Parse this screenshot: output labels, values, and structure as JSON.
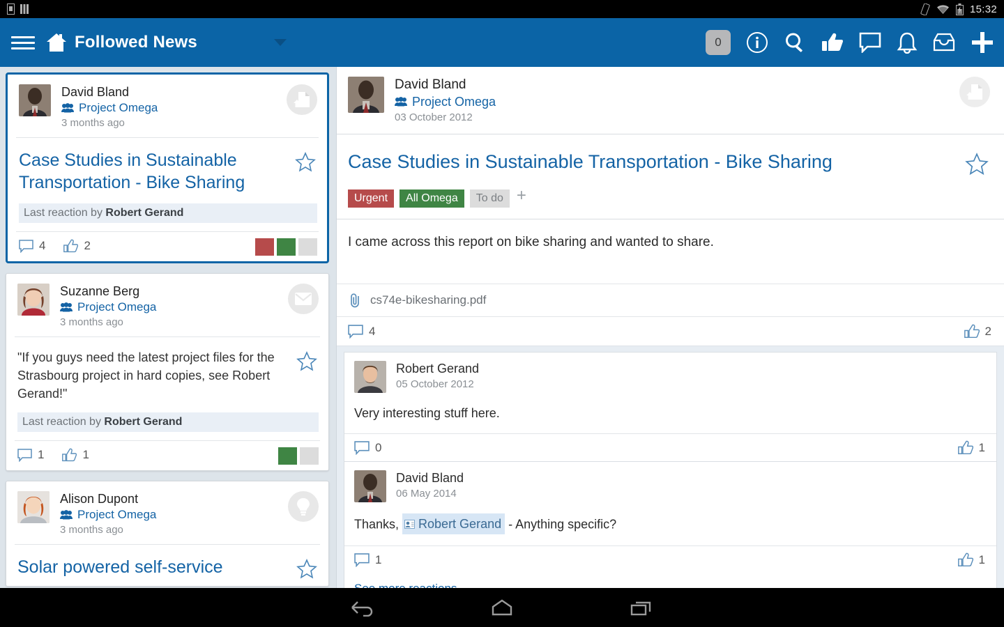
{
  "status_bar": {
    "time": "15:32",
    "icons": [
      "sim-card-icon",
      "signal-bars-icon",
      "rotation-lock-icon",
      "wifi-icon",
      "battery-charging-icon"
    ]
  },
  "app_bar": {
    "menu_icon": "hamburger-menu-icon",
    "home_icon": "home-icon",
    "title": "Followed News",
    "caret_icon": "chevron-down-icon",
    "actions": [
      {
        "name": "counter-badge",
        "label": "0",
        "icon": "counter-badge"
      },
      {
        "name": "info-button",
        "label": "",
        "icon": "info-circle-icon"
      },
      {
        "name": "search-button",
        "label": "",
        "icon": "search-icon"
      },
      {
        "name": "likes-button",
        "label": "",
        "icon": "thumbs-up-icon"
      },
      {
        "name": "comments-button",
        "label": "",
        "icon": "speech-bubble-icon"
      },
      {
        "name": "notifications-button",
        "label": "",
        "icon": "bell-icon"
      },
      {
        "name": "inbox-button",
        "label": "",
        "icon": "inbox-tray-icon"
      },
      {
        "name": "new-post-button",
        "label": "",
        "icon": "plus-icon"
      }
    ]
  },
  "colors": {
    "brand_blue": "#0b64a6",
    "link_blue": "#1463a5",
    "tag_red": "#b64b4b",
    "tag_green": "#3f8544",
    "tag_grey": "#dcdcdc",
    "sidebar_bg": "#dde4ea"
  },
  "sidebar": {
    "cards": [
      {
        "author": "David Bland",
        "group": "Project Omega",
        "group_icon": "group-people-icon",
        "time": "3 months ago",
        "type_icon": "document-upload-icon",
        "title": "Case Studies in Sustainable Transportation - Bike Sharing",
        "star_icon": "star-outline-icon",
        "last_reaction_prefix": "Last reaction by ",
        "last_reaction_name": "Robert Gerand",
        "comment_count": "4",
        "like_count": "2",
        "swatches": [
          "#b64b4b",
          "#3f8544",
          "#dcdcdc"
        ],
        "selected": true
      },
      {
        "author": "Suzanne Berg",
        "group": "Project Omega",
        "group_icon": "group-people-icon",
        "time": "3 months ago",
        "type_icon": "envelope-icon",
        "quote": "\"If you guys need the latest project files for the Strasbourg project in hard copies, see Robert Gerand!\"",
        "star_icon": "star-outline-icon",
        "last_reaction_prefix": "Last reaction by ",
        "last_reaction_name": "Robert Gerand",
        "comment_count": "1",
        "like_count": "1",
        "swatches": [
          "#3f8544",
          "#dcdcdc"
        ],
        "selected": false
      },
      {
        "author": "Alison Dupont",
        "group": "Project Omega",
        "group_icon": "group-people-icon",
        "time": "3 months ago",
        "type_icon": "lightbulb-icon",
        "title": "Solar powered self-service",
        "star_icon": "star-outline-icon",
        "selected": false
      }
    ]
  },
  "detail": {
    "author": "David Bland",
    "group": "Project Omega",
    "group_icon": "group-people-icon",
    "date": "03 October 2012",
    "type_icon": "document-upload-icon",
    "title": "Case Studies in Sustainable Transportation - Bike Sharing",
    "star_icon": "star-outline-icon",
    "tags": [
      {
        "label": "Urgent",
        "style": "red"
      },
      {
        "label": "All Omega",
        "style": "green"
      },
      {
        "label": "To do",
        "style": "grey"
      }
    ],
    "tag_add_label": "+",
    "body": "I came across this report on bike sharing and wanted to share.",
    "attachment": {
      "icon": "paperclip-icon",
      "filename": "cs74e-bikesharing.pdf"
    },
    "comment_count": "4",
    "like_count": "2",
    "comments": [
      {
        "author": "Robert Gerand",
        "date": "05 October 2012",
        "text": "Very interesting stuff here.",
        "comment_count": "0",
        "like_count": "1"
      },
      {
        "author": "David Bland",
        "date": "06 May 2014",
        "text_before": "Thanks, ",
        "mention": "Robert Gerand",
        "mention_icon": "user-card-icon",
        "text_after": " - Anything specific?",
        "comment_count": "1",
        "like_count": "1"
      }
    ],
    "see_more_label": "See more reactions"
  },
  "nav_bar": {
    "buttons": [
      {
        "name": "back-button",
        "icon": "back-arrow-icon"
      },
      {
        "name": "home-button",
        "icon": "home-pentagon-icon"
      },
      {
        "name": "recents-button",
        "icon": "recents-squares-icon"
      }
    ]
  }
}
